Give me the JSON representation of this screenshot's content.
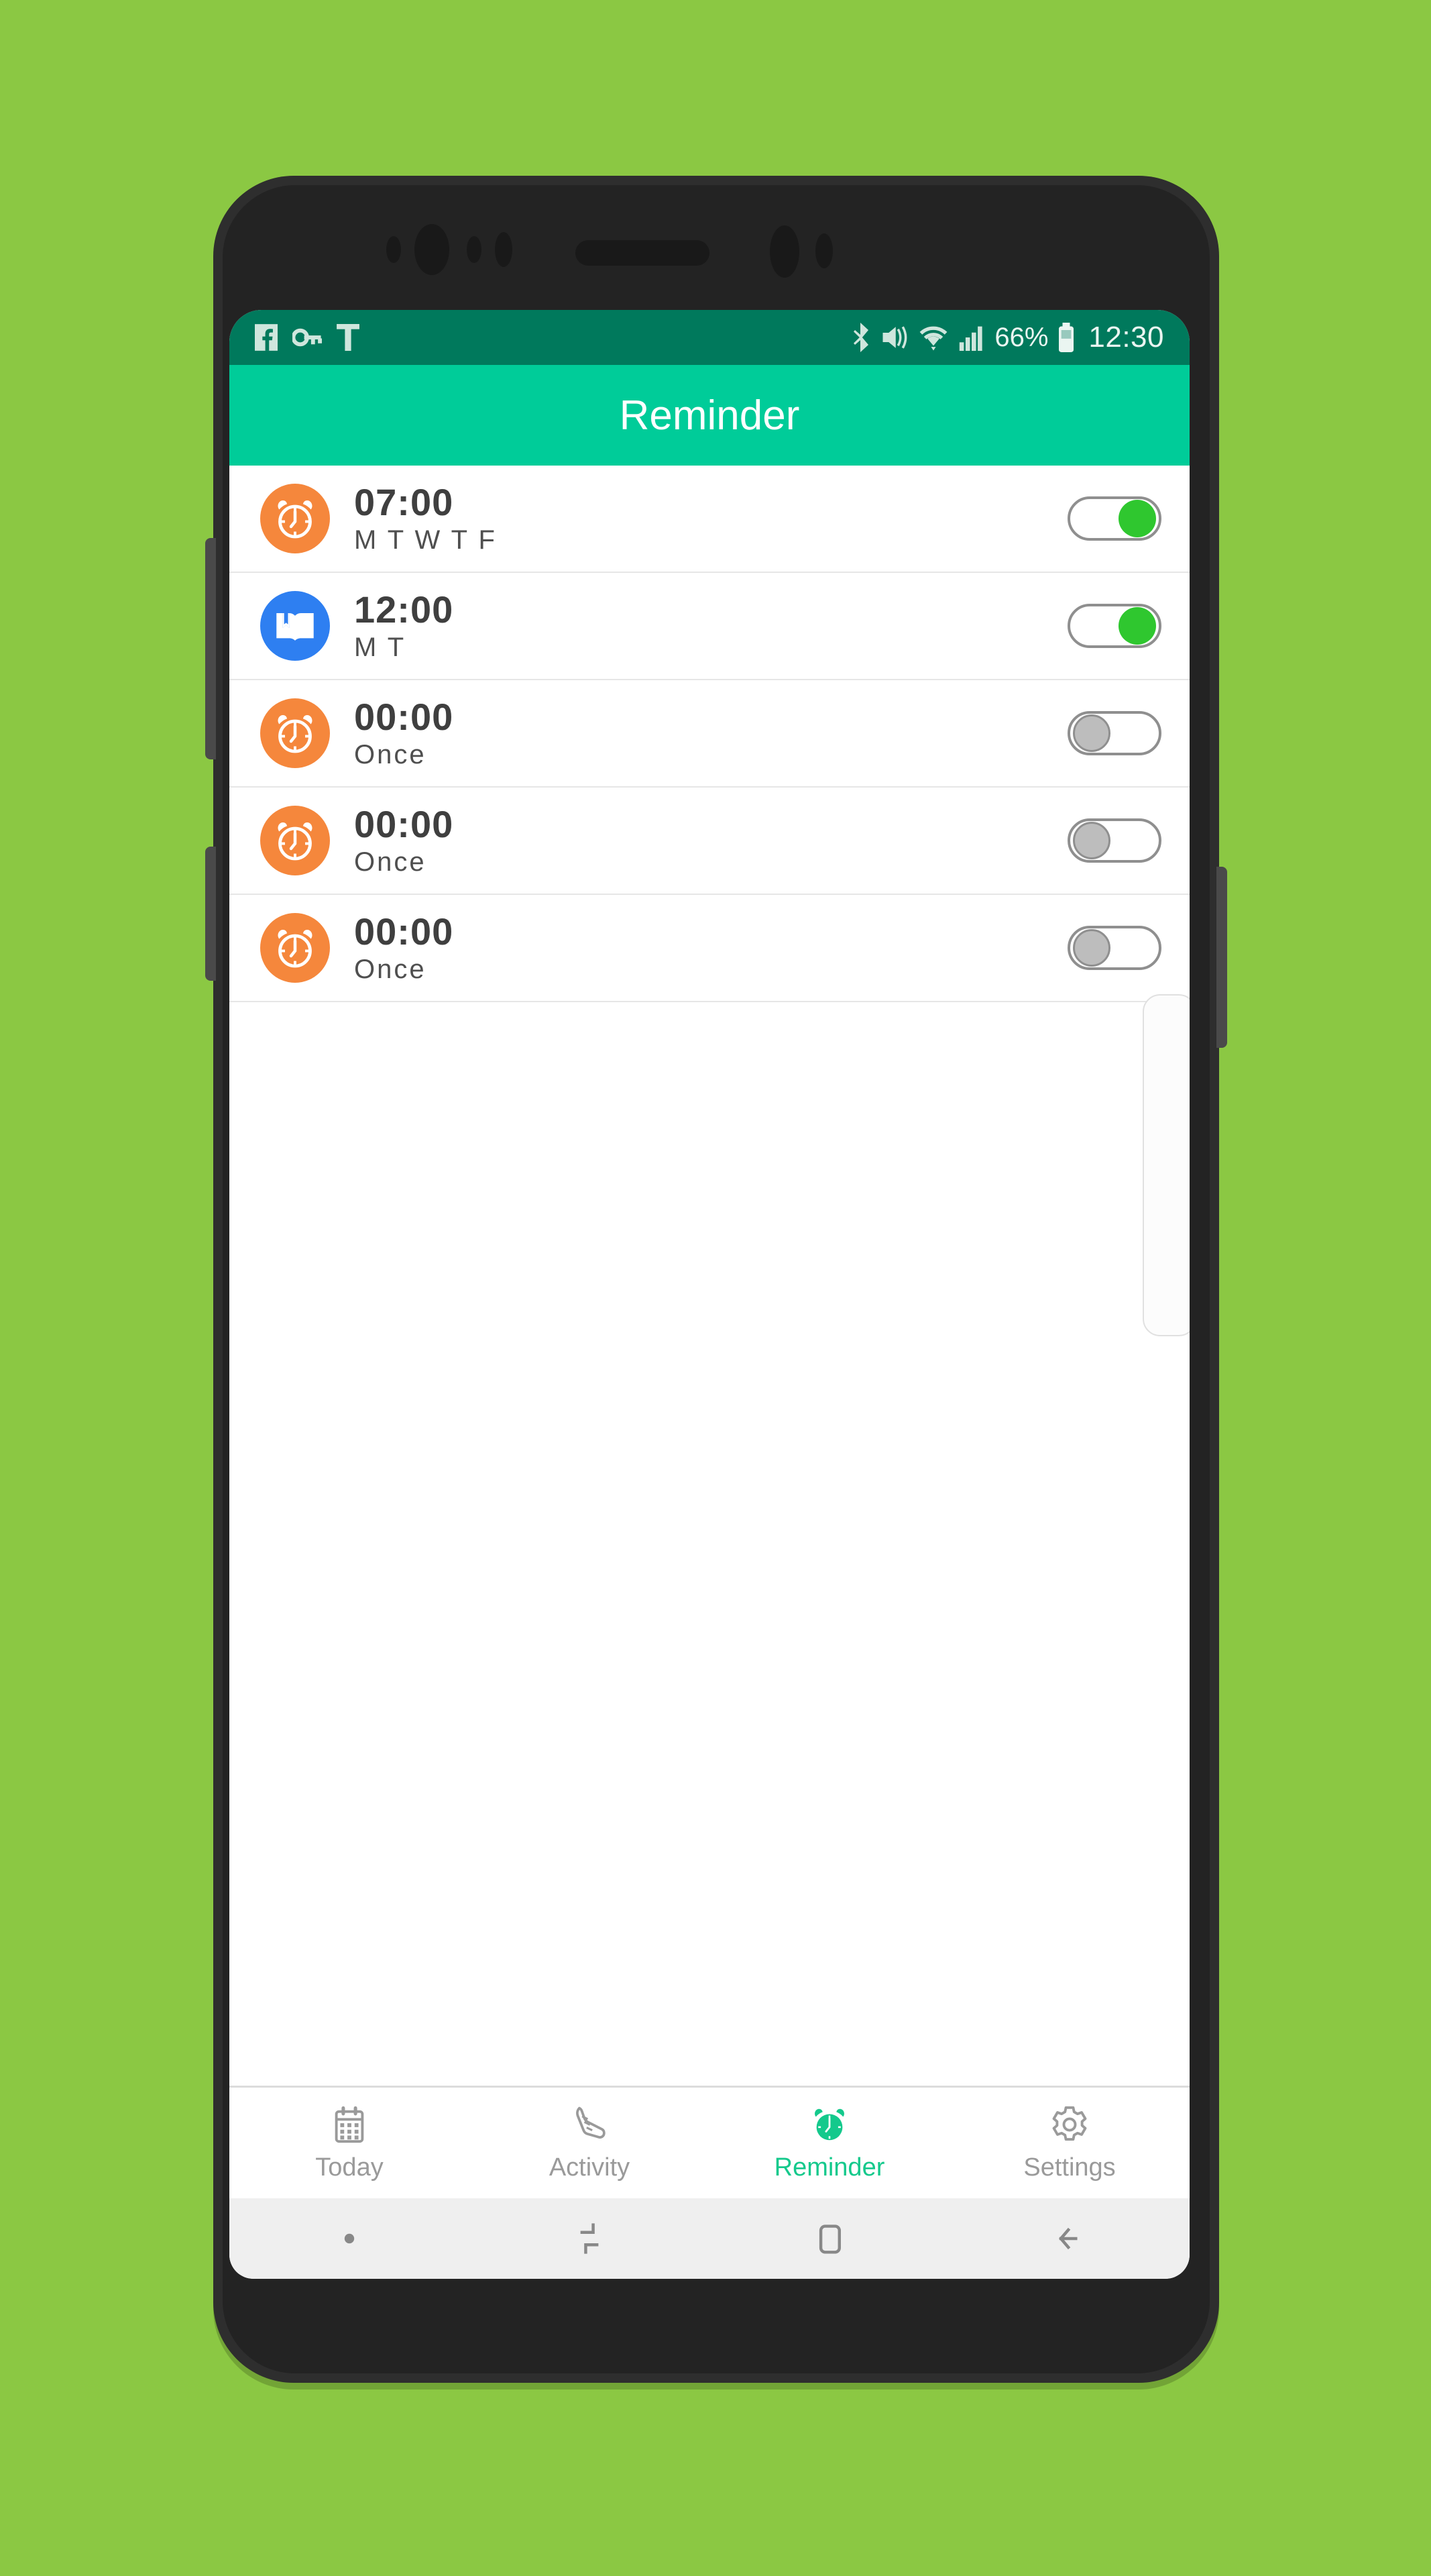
{
  "status_bar": {
    "left_icons": [
      "facebook-icon",
      "vpn-key-icon",
      "text-input-icon"
    ],
    "right_icons": [
      "bluetooth-icon",
      "vibrate-icon",
      "wifi-icon",
      "cellular-signal-icon"
    ],
    "battery_percent": "66%",
    "battery_icon": "battery-icon",
    "clock": "12:30",
    "background_color": "#00795C"
  },
  "app_bar": {
    "title": "Reminder",
    "background_color": "#00CC99"
  },
  "reminders": [
    {
      "icon": "alarm-clock-icon",
      "icon_color": "#F5873C",
      "time": "07:00",
      "days": "M T W T F",
      "enabled": true
    },
    {
      "icon": "open-book-icon",
      "icon_color": "#2E7FF1",
      "time": "12:00",
      "days": "M T",
      "enabled": true
    },
    {
      "icon": "alarm-clock-icon",
      "icon_color": "#F5873C",
      "time": "00:00",
      "days": "Once",
      "enabled": false
    },
    {
      "icon": "alarm-clock-icon",
      "icon_color": "#F5873C",
      "time": "00:00",
      "days": "Once",
      "enabled": false
    },
    {
      "icon": "alarm-clock-icon",
      "icon_color": "#F5873C",
      "time": "00:00",
      "days": "Once",
      "enabled": false
    }
  ],
  "tab_bar": {
    "active_color": "#14C98C",
    "inactive_color": "#9A9A9A",
    "items": [
      {
        "label": "Today",
        "icon": "calendar-icon",
        "active": false
      },
      {
        "label": "Activity",
        "icon": "running-shoe-icon",
        "active": false
      },
      {
        "label": "Reminder",
        "icon": "alarm-clock-icon",
        "active": true
      },
      {
        "label": "Settings",
        "icon": "gear-icon",
        "active": false
      }
    ]
  },
  "android_nav_bar": {
    "items": [
      "dot-indicator-icon",
      "recents-icon",
      "home-icon",
      "back-icon"
    ]
  },
  "page_background_color": "#8BC843"
}
